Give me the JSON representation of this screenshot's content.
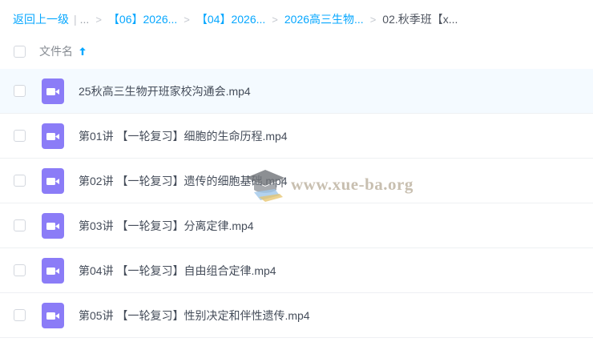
{
  "breadcrumb": {
    "back_label": "返回上一级",
    "ellipsis": "...",
    "items": [
      "【06】2026...",
      "【04】2026...",
      "2026高三生物..."
    ],
    "current": "02.秋季班【x..."
  },
  "header": {
    "name_column": "文件名"
  },
  "files": [
    {
      "name": "25秋高三生物开班家校沟通会.mp4"
    },
    {
      "name": "第01讲 【一轮复习】细胞的生命历程.mp4"
    },
    {
      "name": "第02讲 【一轮复习】遗传的细胞基础.mp4"
    },
    {
      "name": "第03讲 【一轮复习】分离定律.mp4"
    },
    {
      "name": "第04讲 【一轮复习】自由组合定律.mp4"
    },
    {
      "name": "第05讲 【一轮复习】性别决定和伴性遗传.mp4"
    }
  ],
  "watermark": {
    "text": "www.xue-ba.org"
  },
  "colors": {
    "accent": "#06a7ff",
    "video_icon": "#8b7cf7",
    "selected_row": "#f4faff"
  },
  "icons": {
    "file": "video-file-icon",
    "sort": "arrow-up-icon",
    "watermark_logo": "graduation-cap-icon"
  }
}
